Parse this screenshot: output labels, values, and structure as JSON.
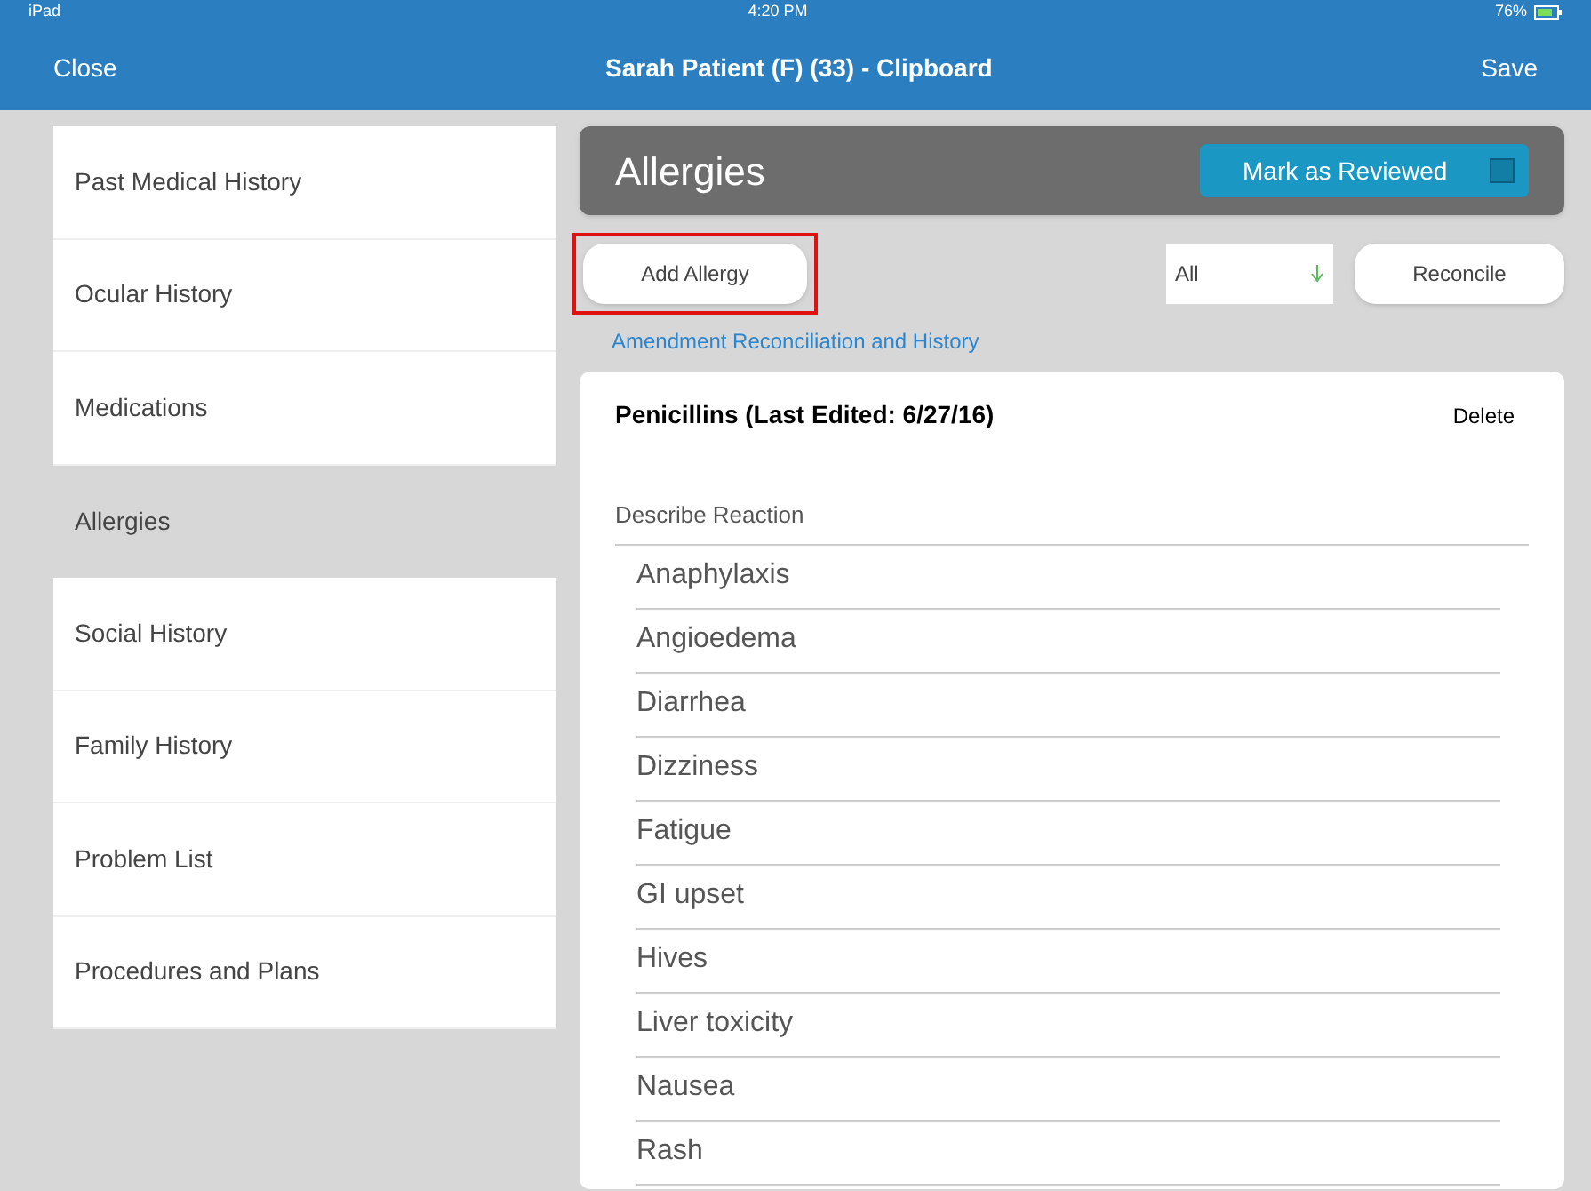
{
  "status_bar": {
    "device": "iPad",
    "time": "4:20 PM",
    "battery": "76%"
  },
  "nav_bar": {
    "left": "Close",
    "title": "Sarah Patient (F) (33)  - Clipboard",
    "right": "Save"
  },
  "sidebar": {
    "items": [
      {
        "label": "Past Medical History",
        "selected": false
      },
      {
        "label": "Ocular History",
        "selected": false
      },
      {
        "label": "Medications",
        "selected": false
      },
      {
        "label": "Allergies",
        "selected": true
      },
      {
        "label": "Social History",
        "selected": false
      },
      {
        "label": "Family History",
        "selected": false
      },
      {
        "label": "Problem List",
        "selected": false
      },
      {
        "label": "Procedures and Plans",
        "selected": false
      }
    ]
  },
  "header": {
    "title": "Allergies",
    "review_button": "Mark as Reviewed",
    "reviewed": false
  },
  "toolbar": {
    "add_button": "Add Allergy",
    "add_highlighted": true,
    "filter": "All",
    "reconcile_button": "Reconcile"
  },
  "link": "Amendment Reconciliation and History",
  "allergy": {
    "title": "Penicillins (Last Edited: 6/27/16)",
    "delete": "Delete",
    "reaction_label": "Describe Reaction",
    "reactions": [
      "Anaphylaxis",
      "Angioedema",
      "Diarrhea",
      "Dizziness",
      "Fatigue",
      "GI upset",
      "Hives",
      "Liver toxicity",
      "Nausea",
      "Rash"
    ]
  }
}
